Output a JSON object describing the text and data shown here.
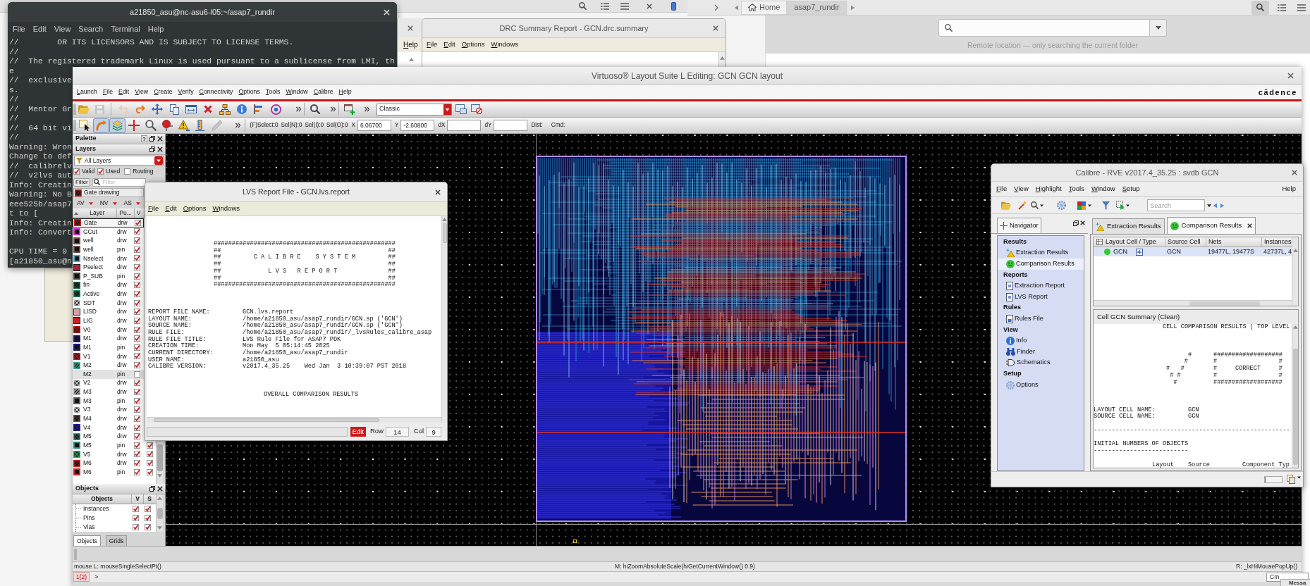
{
  "file_manager": {
    "breadcrumbs": [
      {
        "label": "Home",
        "selected": false
      },
      {
        "label": "asap7_rundir",
        "selected": true
      }
    ],
    "search_hint": "Remote location — only searching the current folder"
  },
  "terminal": {
    "title": "a21850_asu@nc-asu6-l05:~/asap7_rundir",
    "menu": [
      "File",
      "Edit",
      "View",
      "Search",
      "Terminal",
      "Help"
    ],
    "paragraphs": [
      [
        "//        OR ITS LICENSORS AND IS SUBJECT TO LICENSE TERMS.",
        "//",
        "//  The registered trademark Linux is used pursuant to a sublicense from LMI, th",
        "e",
        "//  exclusive",
        "s.",
        "//",
        "//  Mentor Gr",
        "//",
        "//  64 bit vi",
        "//",
        "Warning: Wron",
        "Change to def",
        "//  calibrelv",
        "//  v2lvs aut",
        "Info: Creatin",
        "Warning: No B",
        "eee525b/asap7",
        "t to [",
        "Info: Creatin",
        "Info: Convert"
      ],
      [
        "CPU TIME = 0",
        "[a21850_asu@n"
      ]
    ]
  },
  "help_window": {
    "menu": [
      "Help"
    ]
  },
  "drc_window": {
    "title": "DRC Summary Report - GCN.drc.summary",
    "menu": [
      "File",
      "Edit",
      "Options",
      "Windows"
    ]
  },
  "virtuoso": {
    "title": "Virtuoso® Layout Suite L Editing: GCN GCN layout",
    "menu": [
      "Launch",
      "File",
      "Edit",
      "View",
      "Create",
      "Verify",
      "Connectivity",
      "Options",
      "Tools",
      "Window",
      "Calibre",
      "Help"
    ],
    "logo": "cādence",
    "toolbar": {
      "buttons": [
        {
          "disabled": false
        },
        {
          "disabled": true
        },
        {
          "disabled": true
        },
        {
          "disabled": false
        },
        {
          "disabled": false
        },
        {
          "disabled": false
        },
        {
          "disabled": false
        },
        {
          "disabled": false
        },
        {
          "disabled": false
        },
        {
          "disabled": false
        },
        {
          "disabled": false
        },
        {
          "disabled": false
        },
        {
          "disabled": false
        },
        {
          "disabled": false
        },
        {
          "disabled": false
        },
        {
          "disabled": false
        }
      ],
      "workspace": "Classic"
    },
    "edit_toolbar": {
      "tools": [
        {
          "selected": false,
          "disabled": false
        },
        {
          "selected": true,
          "disabled": false
        },
        {
          "selected": true,
          "disabled": false
        },
        {
          "selected": false,
          "disabled": false
        },
        {
          "selected": false,
          "disabled": false
        },
        {
          "selected": false,
          "disabled": false
        },
        {
          "selected": false,
          "disabled": false
        },
        {
          "selected": false,
          "disabled": false
        },
        {
          "selected": false,
          "disabled": true
        }
      ],
      "counters": [
        "(F)Select:0",
        "Sel(N):0",
        "Sel(I):0",
        "Sel(O):0"
      ],
      "coordinates": [
        {
          "label": "X",
          "value": "6.06700"
        },
        {
          "label": "Y",
          "value": "-2.60800"
        },
        {
          "label": "dX"
        },
        {
          "label": "dY"
        }
      ],
      "labels": [
        "Dist:",
        "Cmd:"
      ]
    },
    "palette": {
      "title": "Palette",
      "help": "?",
      "layers": {
        "title": "Layers",
        "filter": "All Layers",
        "options": [
          {
            "label": "Valid",
            "checked": true
          },
          {
            "label": "Used",
            "checked": true
          },
          {
            "label": "Routing",
            "checked": false
          }
        ],
        "filter_button": "Filter",
        "filter_placeholder": "Filter",
        "current_layer": "Gate drawing",
        "visibility_menus": [
          "AV",
          "NV",
          "AS"
        ],
        "columns": [
          "Layer",
          "Pu...",
          "V"
        ],
        "rows": [
          {
            "name": "Gate",
            "purpose": "drw",
            "color": "#e02020",
            "kind": "dots",
            "selected": true,
            "checks": [
              true
            ]
          },
          {
            "name": "GCut",
            "purpose": "drw",
            "color": "#e020e0",
            "kind": "outline",
            "selected": false,
            "checks": [
              true
            ]
          },
          {
            "name": "well",
            "purpose": "drw",
            "color": "#7a4a3a",
            "kind": "outline",
            "selected": false,
            "checks": [
              true
            ]
          },
          {
            "name": "well",
            "purpose": "pin",
            "color": "#6a4a40",
            "kind": "outline",
            "selected": false,
            "checks": [
              true
            ]
          },
          {
            "name": "Nselect",
            "purpose": "drw",
            "color": "#38b0e0",
            "kind": "outline",
            "selected": false,
            "checks": [
              true
            ]
          },
          {
            "name": "Pselect",
            "purpose": "drw",
            "color": "#a02838",
            "kind": "solid",
            "selected": false,
            "checks": [
              true
            ]
          },
          {
            "name": "P_SUB",
            "purpose": "pin",
            "color": "#404040",
            "kind": "outline",
            "selected": false,
            "checks": [
              true
            ]
          },
          {
            "name": "fin",
            "purpose": "drw",
            "color": "#1a6a4a",
            "kind": "dots",
            "selected": false,
            "checks": [
              true
            ]
          },
          {
            "name": "Active",
            "purpose": "drw",
            "color": "#128a58",
            "kind": "dots",
            "selected": false,
            "checks": [
              true
            ]
          },
          {
            "name": "SDT",
            "purpose": "drw",
            "color": "#e0e0e0",
            "kind": "cross",
            "selected": false,
            "checks": [
              true
            ]
          },
          {
            "name": "LISD",
            "purpose": "drw",
            "color": "#d8a0a8",
            "kind": "solid",
            "selected": false,
            "checks": [
              true
            ]
          },
          {
            "name": "LIG",
            "purpose": "drw",
            "color": "#d02020",
            "kind": "solid",
            "selected": false,
            "checks": [
              true
            ]
          },
          {
            "name": "V0",
            "purpose": "drw",
            "color": "#c01010",
            "kind": "cross",
            "selected": false,
            "checks": [
              true
            ]
          },
          {
            "name": "M1",
            "purpose": "drw",
            "color": "#1a1a90",
            "kind": "dots",
            "selected": false,
            "checks": [
              true
            ]
          },
          {
            "name": "M1",
            "purpose": "pin",
            "color": "#1a1a80",
            "kind": "outline",
            "selected": false,
            "checks": [
              true
            ]
          },
          {
            "name": "V1",
            "purpose": "drw",
            "color": "#d01818",
            "kind": "cross",
            "selected": false,
            "checks": [
              true
            ]
          },
          {
            "name": "M2",
            "purpose": "drw",
            "color": "#40b0a0",
            "kind": "hatch",
            "selected": false,
            "checks": [
              true
            ]
          },
          {
            "name": "M2",
            "purpose": "pin",
            "kind": "none",
            "selected": false,
            "checks": [
              false
            ]
          },
          {
            "name": "V2",
            "purpose": "drw",
            "color": "#d8d8d8",
            "kind": "cross",
            "selected": false,
            "checks": [
              true
            ]
          },
          {
            "name": "M3",
            "purpose": "drw",
            "color": "#b0b0b0",
            "kind": "hatch",
            "selected": false,
            "checks": [
              true
            ]
          },
          {
            "name": "M3",
            "purpose": "pin",
            "color": "#606060",
            "kind": "outline",
            "selected": false,
            "checks": [
              true
            ]
          },
          {
            "name": "V3",
            "purpose": "drw",
            "color": "#f0f0f0",
            "kind": "cross",
            "selected": false,
            "checks": [
              true
            ]
          },
          {
            "name": "M4",
            "purpose": "drw",
            "color": "#7a4a4a",
            "kind": "dots",
            "selected": false,
            "checks": [
              true
            ]
          },
          {
            "name": "V4",
            "purpose": "drw",
            "color": "#2020a0",
            "kind": "cross",
            "selected": false,
            "checks": [
              true
            ]
          },
          {
            "name": "M5",
            "purpose": "drw",
            "color": "#30a090",
            "kind": "dots",
            "selected": false,
            "checks": [
              true
            ]
          },
          {
            "name": "M5",
            "purpose": "pin",
            "color": "#2a8a80",
            "kind": "outline",
            "selected": false,
            "checks": [
              true,
              true
            ]
          },
          {
            "name": "V5",
            "purpose": "drw",
            "color": "#20b060",
            "kind": "cross",
            "selected": false,
            "checks": [
              true,
              true
            ]
          },
          {
            "name": "M6",
            "purpose": "drw",
            "color": "#e02020",
            "kind": "dots",
            "selected": false,
            "checks": [
              true,
              true
            ]
          },
          {
            "name": "M6",
            "purpose": "pin",
            "color": "#e02020",
            "kind": "outline",
            "selected": false,
            "checks": [
              true,
              true
            ]
          }
        ]
      },
      "objects": {
        "title": "Objects",
        "columns": [
          "Objects",
          "V",
          "S"
        ],
        "rows": [
          {
            "label": "Instances",
            "visible": true,
            "selectable": true
          },
          {
            "label": "Pins",
            "visible": true,
            "selectable": true
          },
          {
            "label": "Vias",
            "visible": true,
            "selectable": true
          }
        ]
      },
      "tabs": [
        {
          "label": "Objects",
          "selected": true
        },
        {
          "label": "Grids",
          "selected": false
        }
      ]
    },
    "status_bar": {
      "left": "mouse L: mouseSingleSelectPt()",
      "middle": "M: hiZoomAbsoluteScale(hiGetCurrentWindow() 0.9)",
      "right": "R: _lxHiMousePopUp()"
    },
    "command_line": {
      "history": "1(2)",
      "prompt": ">",
      "trailing": "Cm"
    }
  },
  "lvs_report": {
    "title": "LVS Report File - GCN.lvs.report",
    "menu": [
      "File",
      "Edit",
      "Options",
      "Windows"
    ],
    "banner": [
      "##################################################",
      "##                                              ##",
      "##         C A L I B R E    S Y S T E M         ##",
      "##                                              ##",
      "##             L V S   R E P O R T              ##",
      "##                                              ##",
      "##################################################"
    ],
    "fields": [
      {
        "label": "REPORT FILE NAME:",
        "value": "GCN.lvs.report"
      },
      {
        "label": "LAYOUT NAME:",
        "value": "/home/a21850_asu/asap7_rundir/GCN.sp ('GCN')"
      },
      {
        "label": "SOURCE NAME:",
        "value": "/home/a21850_asu/asap7_rundir/GCN.sp ('GCN')"
      },
      {
        "label": "RULE FILE:",
        "value": "/home/a21850_asu/asap7_rundir/_lvsRules_calibre_asap"
      },
      {
        "label": "RULE FILE TITLE:",
        "value": "LVS Rule File for ASAP7 PDK"
      },
      {
        "label": "CREATION TIME:",
        "value": "Mon May  5 05:14:45 2025"
      },
      {
        "label": "CURRENT DIRECTORY:",
        "value": "/home/a21850_asu/asap7_rundir"
      },
      {
        "label": "USER NAME:",
        "value": "a21850_asu"
      },
      {
        "label": "CALIBRE VERSION:",
        "value": "v2017.4_35.25    Wed Jan  3 10:39:07 PST 2018"
      }
    ],
    "heading": "OVERALL COMPARISON RESULTS",
    "status": {
      "mode": "Edit",
      "row_label": "Row",
      "row": "14",
      "col_label": "Col",
      "col": "9"
    }
  },
  "rve": {
    "title": "Calibre - RVE v2017.4_35.25 : svdb GCN",
    "menu": [
      "File",
      "View",
      "Highlight",
      "Tools",
      "Window",
      "Setup"
    ],
    "help": "Help",
    "search_placeholder": "Search",
    "navigator": {
      "title": "Navigator",
      "sections": [
        {
          "title": "Results",
          "items": [
            {
              "label": "Extraction Results",
              "selected": false
            },
            {
              "label": "Comparison Results",
              "selected": true
            }
          ]
        },
        {
          "title": "Reports",
          "items": [
            {
              "label": "Extraction Report",
              "selected": false
            },
            {
              "label": "LVS Report",
              "selected": false
            }
          ]
        },
        {
          "title": "Rules",
          "items": [
            {
              "label": "Rules File",
              "selected": false
            }
          ]
        },
        {
          "title": "View",
          "items": [
            {
              "label": "Info",
              "selected": false
            },
            {
              "label": "Finder",
              "selected": false
            },
            {
              "label": "Schematics",
              "selected": false
            }
          ]
        },
        {
          "title": "Setup",
          "items": [
            {
              "label": "Options",
              "selected": false
            }
          ]
        }
      ]
    },
    "tabs": [
      {
        "label": "Extraction Results",
        "selected": false
      },
      {
        "label": "Comparison Results",
        "selected": true
      }
    ],
    "results": {
      "columns": [
        "Layout Cell / Type",
        "Source Cell",
        "Nets",
        "Instances"
      ],
      "rows": [
        {
          "layout_cell": "GCN",
          "source_cell": "GCN",
          "nets": "19477L, 19477S",
          "instances": "42737L, 4",
          "color": "#2ecc2e",
          "selected": true
        }
      ]
    },
    "summary": {
      "title": "Cell GCN Summary (Clean)",
      "heading": "CELL COMPARISON RESULTS ( TOP LEVEL",
      "verdict": [
        "      #      ###################",
        "     #       #                 #",
        "#   #        #     CORRECT     #",
        " # #         #                 #",
        "  #          ###################"
      ],
      "cells": [
        {
          "label": "LAYOUT CELL NAME:",
          "value": "GCN"
        },
        {
          "label": "SOURCE CELL NAME:",
          "value": "GCN"
        }
      ],
      "rule": "------------------------------------------------------",
      "section": "INITIAL NUMBERS OF OBJECTS",
      "section_rule": "--------------------------",
      "columns": [
        "Layout",
        "Source",
        "Component Typ"
      ]
    },
    "status_bar": {
      "progress": {
        "level": 0.05
      }
    }
  },
  "message_window": {
    "title": "Messa"
  }
}
